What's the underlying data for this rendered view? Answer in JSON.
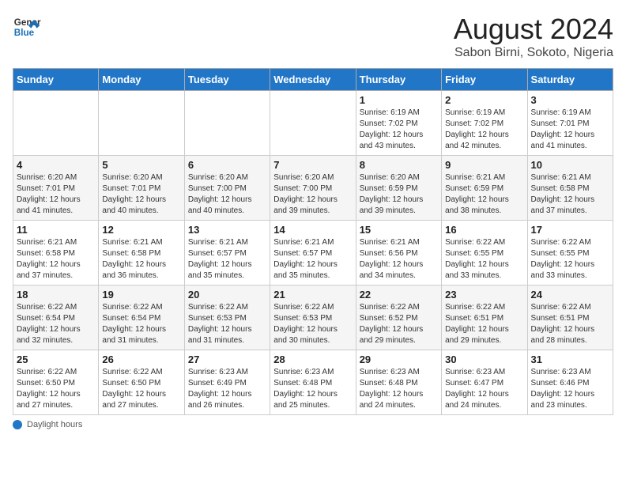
{
  "header": {
    "logo_line1": "General",
    "logo_line2": "Blue",
    "title": "August 2024",
    "subtitle": "Sabon Birni, Sokoto, Nigeria"
  },
  "days_of_week": [
    "Sunday",
    "Monday",
    "Tuesday",
    "Wednesday",
    "Thursday",
    "Friday",
    "Saturday"
  ],
  "footer": {
    "label": "Daylight hours"
  },
  "weeks": [
    [
      {
        "day": "",
        "info": ""
      },
      {
        "day": "",
        "info": ""
      },
      {
        "day": "",
        "info": ""
      },
      {
        "day": "",
        "info": ""
      },
      {
        "day": "1",
        "info": "Sunrise: 6:19 AM\nSunset: 7:02 PM\nDaylight: 12 hours\nand 43 minutes."
      },
      {
        "day": "2",
        "info": "Sunrise: 6:19 AM\nSunset: 7:02 PM\nDaylight: 12 hours\nand 42 minutes."
      },
      {
        "day": "3",
        "info": "Sunrise: 6:19 AM\nSunset: 7:01 PM\nDaylight: 12 hours\nand 41 minutes."
      }
    ],
    [
      {
        "day": "4",
        "info": "Sunrise: 6:20 AM\nSunset: 7:01 PM\nDaylight: 12 hours\nand 41 minutes."
      },
      {
        "day": "5",
        "info": "Sunrise: 6:20 AM\nSunset: 7:01 PM\nDaylight: 12 hours\nand 40 minutes."
      },
      {
        "day": "6",
        "info": "Sunrise: 6:20 AM\nSunset: 7:00 PM\nDaylight: 12 hours\nand 40 minutes."
      },
      {
        "day": "7",
        "info": "Sunrise: 6:20 AM\nSunset: 7:00 PM\nDaylight: 12 hours\nand 39 minutes."
      },
      {
        "day": "8",
        "info": "Sunrise: 6:20 AM\nSunset: 6:59 PM\nDaylight: 12 hours\nand 39 minutes."
      },
      {
        "day": "9",
        "info": "Sunrise: 6:21 AM\nSunset: 6:59 PM\nDaylight: 12 hours\nand 38 minutes."
      },
      {
        "day": "10",
        "info": "Sunrise: 6:21 AM\nSunset: 6:58 PM\nDaylight: 12 hours\nand 37 minutes."
      }
    ],
    [
      {
        "day": "11",
        "info": "Sunrise: 6:21 AM\nSunset: 6:58 PM\nDaylight: 12 hours\nand 37 minutes."
      },
      {
        "day": "12",
        "info": "Sunrise: 6:21 AM\nSunset: 6:58 PM\nDaylight: 12 hours\nand 36 minutes."
      },
      {
        "day": "13",
        "info": "Sunrise: 6:21 AM\nSunset: 6:57 PM\nDaylight: 12 hours\nand 35 minutes."
      },
      {
        "day": "14",
        "info": "Sunrise: 6:21 AM\nSunset: 6:57 PM\nDaylight: 12 hours\nand 35 minutes."
      },
      {
        "day": "15",
        "info": "Sunrise: 6:21 AM\nSunset: 6:56 PM\nDaylight: 12 hours\nand 34 minutes."
      },
      {
        "day": "16",
        "info": "Sunrise: 6:22 AM\nSunset: 6:55 PM\nDaylight: 12 hours\nand 33 minutes."
      },
      {
        "day": "17",
        "info": "Sunrise: 6:22 AM\nSunset: 6:55 PM\nDaylight: 12 hours\nand 33 minutes."
      }
    ],
    [
      {
        "day": "18",
        "info": "Sunrise: 6:22 AM\nSunset: 6:54 PM\nDaylight: 12 hours\nand 32 minutes."
      },
      {
        "day": "19",
        "info": "Sunrise: 6:22 AM\nSunset: 6:54 PM\nDaylight: 12 hours\nand 31 minutes."
      },
      {
        "day": "20",
        "info": "Sunrise: 6:22 AM\nSunset: 6:53 PM\nDaylight: 12 hours\nand 31 minutes."
      },
      {
        "day": "21",
        "info": "Sunrise: 6:22 AM\nSunset: 6:53 PM\nDaylight: 12 hours\nand 30 minutes."
      },
      {
        "day": "22",
        "info": "Sunrise: 6:22 AM\nSunset: 6:52 PM\nDaylight: 12 hours\nand 29 minutes."
      },
      {
        "day": "23",
        "info": "Sunrise: 6:22 AM\nSunset: 6:51 PM\nDaylight: 12 hours\nand 29 minutes."
      },
      {
        "day": "24",
        "info": "Sunrise: 6:22 AM\nSunset: 6:51 PM\nDaylight: 12 hours\nand 28 minutes."
      }
    ],
    [
      {
        "day": "25",
        "info": "Sunrise: 6:22 AM\nSunset: 6:50 PM\nDaylight: 12 hours\nand 27 minutes."
      },
      {
        "day": "26",
        "info": "Sunrise: 6:22 AM\nSunset: 6:50 PM\nDaylight: 12 hours\nand 27 minutes."
      },
      {
        "day": "27",
        "info": "Sunrise: 6:23 AM\nSunset: 6:49 PM\nDaylight: 12 hours\nand 26 minutes."
      },
      {
        "day": "28",
        "info": "Sunrise: 6:23 AM\nSunset: 6:48 PM\nDaylight: 12 hours\nand 25 minutes."
      },
      {
        "day": "29",
        "info": "Sunrise: 6:23 AM\nSunset: 6:48 PM\nDaylight: 12 hours\nand 24 minutes."
      },
      {
        "day": "30",
        "info": "Sunrise: 6:23 AM\nSunset: 6:47 PM\nDaylight: 12 hours\nand 24 minutes."
      },
      {
        "day": "31",
        "info": "Sunrise: 6:23 AM\nSunset: 6:46 PM\nDaylight: 12 hours\nand 23 minutes."
      }
    ]
  ]
}
